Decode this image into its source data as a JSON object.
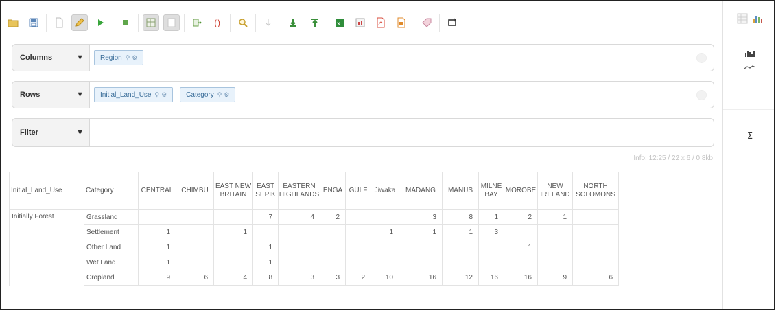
{
  "toolbar": {
    "icons": [
      "open-folder-icon",
      "save-icon",
      "new-document-icon",
      "edit-pencil-icon",
      "run-icon",
      "stop-icon",
      "grid-icon",
      "blank-icon",
      "export-icon",
      "parentheses-icon",
      "zoom-icon",
      "drill-icon",
      "sort-asc-icon",
      "sort-desc-icon",
      "spreadsheet-icon",
      "chart-icon",
      "pdf-icon",
      "xml-icon",
      "tag-icon",
      "refresh-icon"
    ]
  },
  "right_panel": {
    "sigma": "Σ"
  },
  "axes": {
    "columns": {
      "label": "Columns",
      "pills": [
        "Region"
      ]
    },
    "rows": {
      "label": "Rows",
      "pills": [
        "Initial_Land_Use",
        "Category"
      ]
    },
    "filter": {
      "label": "Filter",
      "pills": []
    }
  },
  "info": "Info: 12:25  / 22 x 6 / 0.8kb",
  "table": {
    "row_headers": [
      "Initial_Land_Use",
      "Category"
    ],
    "columns": [
      "CENTRAL",
      "CHIMBU",
      "EAST NEW BRITAIN",
      "EAST SEPIK",
      "EASTERN HIGHLANDS",
      "ENGA",
      "GULF",
      "Jiwaka",
      "MADANG",
      "MANUS",
      "MILNE BAY",
      "MOROBE",
      "NEW IRELAND",
      "NORTH SOLOMONS"
    ],
    "group": "Initially Forest",
    "rows": [
      {
        "category": "Grassland",
        "values": [
          "",
          "",
          "",
          "7",
          "4",
          "2",
          "",
          "",
          "3",
          "8",
          "1",
          "2",
          "1",
          ""
        ]
      },
      {
        "category": "Settlement",
        "values": [
          "1",
          "",
          "1",
          "",
          "",
          "",
          "",
          "1",
          "1",
          "1",
          "3",
          "",
          "",
          ""
        ]
      },
      {
        "category": "Other Land",
        "values": [
          "1",
          "",
          "",
          "1",
          "",
          "",
          "",
          "",
          "",
          "",
          "",
          "1",
          "",
          ""
        ]
      },
      {
        "category": "Wet Land",
        "values": [
          "1",
          "",
          "",
          "1",
          "",
          "",
          "",
          "",
          "",
          "",
          "",
          "",
          "",
          ""
        ]
      },
      {
        "category": "Cropland",
        "values": [
          "9",
          "6",
          "4",
          "8",
          "3",
          "3",
          "2",
          "10",
          "16",
          "12",
          "16",
          "16",
          "9",
          "6"
        ]
      }
    ]
  }
}
